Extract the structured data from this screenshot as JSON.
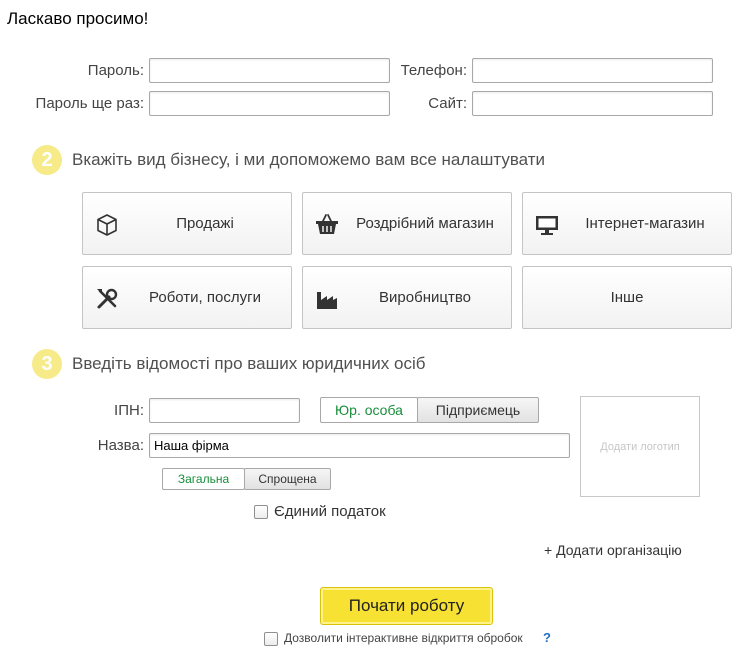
{
  "page": {
    "title": "Ласкаво просимо!"
  },
  "form": {
    "password_label": "Пароль:",
    "password_repeat_label": "Пароль ще раз:",
    "phone_label": "Телефон:",
    "site_label": "Сайт:",
    "password_value": "",
    "password_repeat_value": "",
    "phone_value": "",
    "site_value": ""
  },
  "step2": {
    "number": "2",
    "text": "Вкажіть вид бізнесу, і ми допоможемо вам все налаштувати",
    "tiles": [
      {
        "label": "Продажі",
        "icon": "box-icon"
      },
      {
        "label": "Роздрібний магазин",
        "icon": "shopping-basket-icon"
      },
      {
        "label": "Інтернет-магазин",
        "icon": "monitor-icon"
      },
      {
        "label": "Роботи, послуги",
        "icon": "tools-icon"
      },
      {
        "label": "Виробництво",
        "icon": "factory-icon"
      },
      {
        "label": "Інше",
        "icon": ""
      }
    ]
  },
  "step3": {
    "number": "3",
    "text": "Введіть відомості про ваших юридичних осіб",
    "ipn_label": "ІПН:",
    "ipn_value": "",
    "entity_types": [
      "Юр. особа",
      "Підприємець"
    ],
    "entity_selected": "Юр. особа",
    "name_label": "Назва:",
    "name_value": "Наша фірма",
    "tax_systems": [
      "Загальна",
      "Спрощена"
    ],
    "tax_selected": "Загальна",
    "single_tax_label": "Єдиний податок",
    "single_tax_checked": false,
    "add_logo_label": "Додати логотип",
    "add_org_label": "+ Додати організацію"
  },
  "footer": {
    "start_button": "Почати роботу",
    "interactive_label": "Дозволити інтерактивне відкриття обробок",
    "interactive_checked": false,
    "help_label": "?"
  },
  "colors": {
    "accent_green": "#178f3a",
    "start_yellow": "#f7e233",
    "step_circle": "#f6eb88",
    "help_blue": "#1f6fc7"
  }
}
